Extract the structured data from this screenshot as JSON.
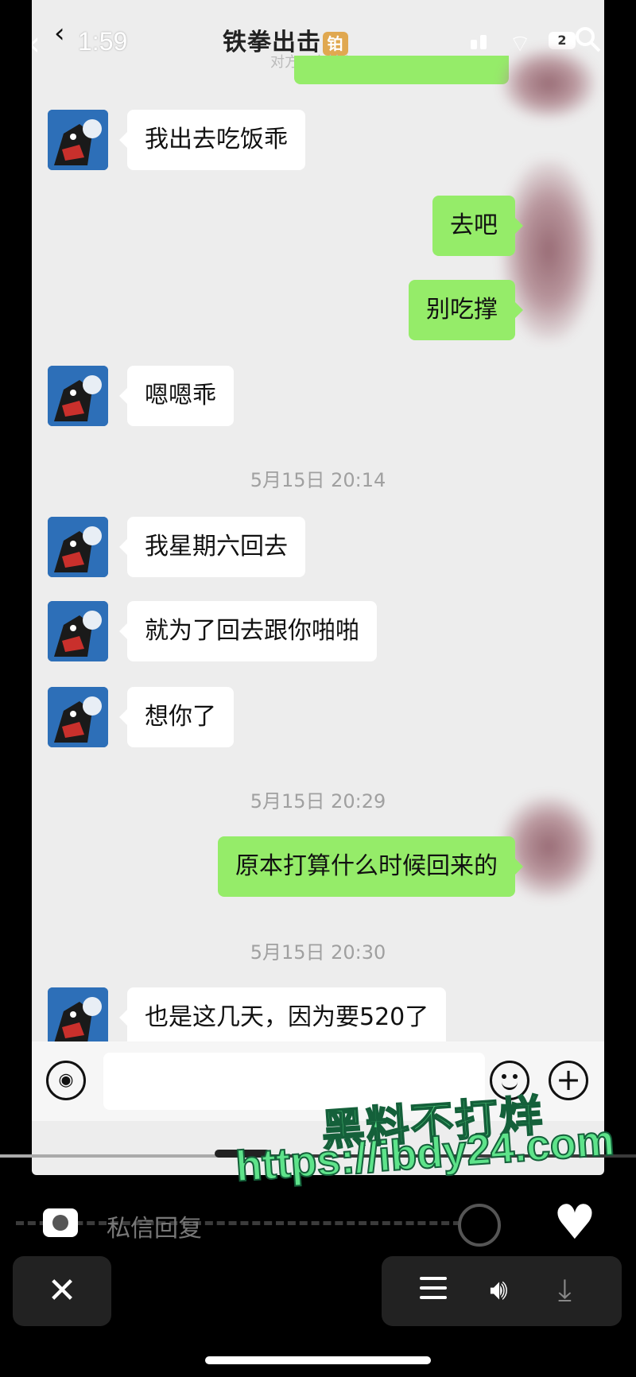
{
  "status": {
    "time": "1:59",
    "battery": "2"
  },
  "header": {
    "title": "铁拳出击",
    "title_tag": "铂",
    "subtitle": "对方正在输入"
  },
  "messages": [
    {
      "side": "in",
      "text": "我出去吃饭乖"
    },
    {
      "side": "out",
      "text": "去吧"
    },
    {
      "side": "out",
      "text": "别吃撑"
    },
    {
      "side": "in",
      "text": "嗯嗯乖"
    },
    {
      "type": "time",
      "text": "5月15日 20:14"
    },
    {
      "side": "in",
      "text": "我星期六回去"
    },
    {
      "side": "in",
      "text": "就为了回去跟你啪啪"
    },
    {
      "side": "in",
      "text": "想你了"
    },
    {
      "type": "time",
      "text": "5月15日 20:29"
    },
    {
      "side": "out",
      "text": "原本打算什么时候回来的"
    },
    {
      "type": "time",
      "text": "5月15日 20:30"
    },
    {
      "side": "in",
      "text": "也是这几天，因为要520了"
    }
  ],
  "watermark": {
    "line1": "黑料不打烊",
    "line2": "https://ibdy24.com"
  },
  "player": {
    "reply_placeholder": "私信回复",
    "progress": 0.36
  },
  "colors": {
    "outgoing_bubble": "#95ec69",
    "incoming_bubble": "#ffffff",
    "watermark": "#5ee38a"
  }
}
